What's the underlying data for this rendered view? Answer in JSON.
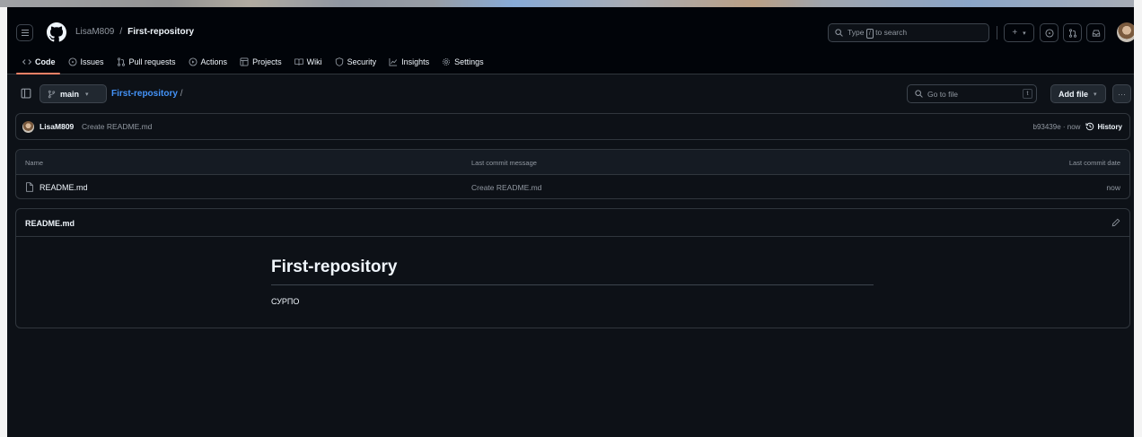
{
  "header": {
    "owner": "LisaM809",
    "separator": "/",
    "repo": "First-repository",
    "search_prefix": "Type",
    "search_key": "/",
    "search_suffix": "to search",
    "new_label": "+",
    "new_caret": "▾"
  },
  "nav": {
    "tabs": [
      {
        "label": "Code",
        "icon": "code-icon"
      },
      {
        "label": "Issues",
        "icon": "issue-icon"
      },
      {
        "label": "Pull requests",
        "icon": "pull-request-icon"
      },
      {
        "label": "Actions",
        "icon": "play-icon"
      },
      {
        "label": "Projects",
        "icon": "table-icon"
      },
      {
        "label": "Wiki",
        "icon": "book-icon"
      },
      {
        "label": "Security",
        "icon": "shield-icon"
      },
      {
        "label": "Insights",
        "icon": "graph-icon"
      },
      {
        "label": "Settings",
        "icon": "gear-icon"
      }
    ]
  },
  "toolbar": {
    "branch": "main",
    "path_repo": "First-repository",
    "path_sep": "/",
    "goto_placeholder": "Go to file",
    "goto_key": "t",
    "add_file": "Add file",
    "more": "···"
  },
  "commit": {
    "author": "LisaM809",
    "message": "Create README.md",
    "hash_time": "b93439e · now",
    "history": "History"
  },
  "file_table": {
    "headers": {
      "name": "Name",
      "message": "Last commit message",
      "date": "Last commit date"
    },
    "rows": [
      {
        "name": "README.md",
        "message": "Create README.md",
        "date": "now"
      }
    ]
  },
  "readme": {
    "filename": "README.md",
    "heading": "First-repository",
    "body": "СУРПО"
  },
  "colors": {
    "background": "#0d1117",
    "link": "#4493f8",
    "active_tab_underline": "#f78166"
  }
}
